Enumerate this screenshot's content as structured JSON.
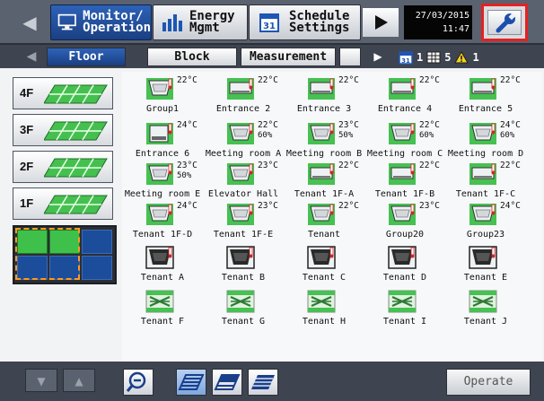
{
  "top_menu": {
    "monitor_label": "Monitor/\nOperation",
    "energy_label": "Energy\nMgmt",
    "schedule_label": "Schedule\nSettings",
    "date": "27/03/2015",
    "time": "11:47"
  },
  "tabs": {
    "floor": "Floor",
    "block": "Block",
    "measurement": "Measurement",
    "group_count": "1",
    "block_count": "5",
    "alert_count": "1"
  },
  "floors": [
    "4F",
    "3F",
    "2F",
    "1F"
  ],
  "units": [
    {
      "name": "Group1",
      "type": "ceiling",
      "temp": "22°C",
      "hum": ""
    },
    {
      "name": "Entrance 2",
      "type": "wall",
      "temp": "22°C",
      "hum": ""
    },
    {
      "name": "Entrance 3",
      "type": "wall",
      "temp": "22°C",
      "hum": ""
    },
    {
      "name": "Entrance 4",
      "type": "wall",
      "temp": "22°C",
      "hum": ""
    },
    {
      "name": "Entrance 5",
      "type": "wall",
      "temp": "22°C",
      "hum": ""
    },
    {
      "name": "Entrance 6",
      "type": "floorunit",
      "temp": "24°C",
      "hum": ""
    },
    {
      "name": "Meeting room A",
      "type": "ceiling",
      "temp": "22°C",
      "hum": "60%"
    },
    {
      "name": "Meeting room B",
      "type": "ceiling",
      "temp": "23°C",
      "hum": "50%"
    },
    {
      "name": "Meeting room C",
      "type": "ceiling",
      "temp": "22°C",
      "hum": "60%"
    },
    {
      "name": "Meeting room D",
      "type": "ceiling",
      "temp": "24°C",
      "hum": "60%"
    },
    {
      "name": "Meeting room E",
      "type": "ceiling",
      "temp": "23°C",
      "hum": "50%"
    },
    {
      "name": "Elevator Hall",
      "type": "ceiling",
      "temp": "23°C",
      "hum": ""
    },
    {
      "name": "Tenant 1F-A",
      "type": "wall",
      "temp": "22°C",
      "hum": ""
    },
    {
      "name": "Tenant 1F-B",
      "type": "wall",
      "temp": "22°C",
      "hum": ""
    },
    {
      "name": "Tenant 1F-C",
      "type": "wall",
      "temp": "22°C",
      "hum": ""
    },
    {
      "name": "Tenant 1F-D",
      "type": "ceiling",
      "temp": "24°C",
      "hum": ""
    },
    {
      "name": "Tenant 1F-E",
      "type": "ceiling",
      "temp": "23°C",
      "hum": ""
    },
    {
      "name": "Tenant",
      "type": "ceiling",
      "temp": "22°C",
      "hum": ""
    },
    {
      "name": "Group20",
      "type": "ceiling",
      "temp": "23°C",
      "hum": ""
    },
    {
      "name": "Group23",
      "type": "ceiling",
      "temp": "24°C",
      "hum": ""
    },
    {
      "name": "Tenant A",
      "type": "dark",
      "temp": "",
      "hum": ""
    },
    {
      "name": "Tenant B",
      "type": "dark",
      "temp": "",
      "hum": ""
    },
    {
      "name": "Tenant C",
      "type": "dark",
      "temp": "",
      "hum": ""
    },
    {
      "name": "Tenant D",
      "type": "dark",
      "temp": "",
      "hum": ""
    },
    {
      "name": "Tenant E",
      "type": "dark",
      "temp": "",
      "hum": ""
    },
    {
      "name": "Tenant F",
      "type": "vent",
      "temp": "",
      "hum": ""
    },
    {
      "name": "Tenant G",
      "type": "vent",
      "temp": "",
      "hum": ""
    },
    {
      "name": "Tenant H",
      "type": "vent",
      "temp": "",
      "hum": ""
    },
    {
      "name": "Tenant I",
      "type": "vent",
      "temp": "",
      "hum": ""
    },
    {
      "name": "Tenant J",
      "type": "vent",
      "temp": "",
      "hum": ""
    }
  ],
  "bottom": {
    "operate_label": "Operate"
  },
  "colors": {
    "active_blue": "#1f4b9a",
    "unit_green": "#3fbf4a",
    "highlight_red": "#e52121"
  }
}
